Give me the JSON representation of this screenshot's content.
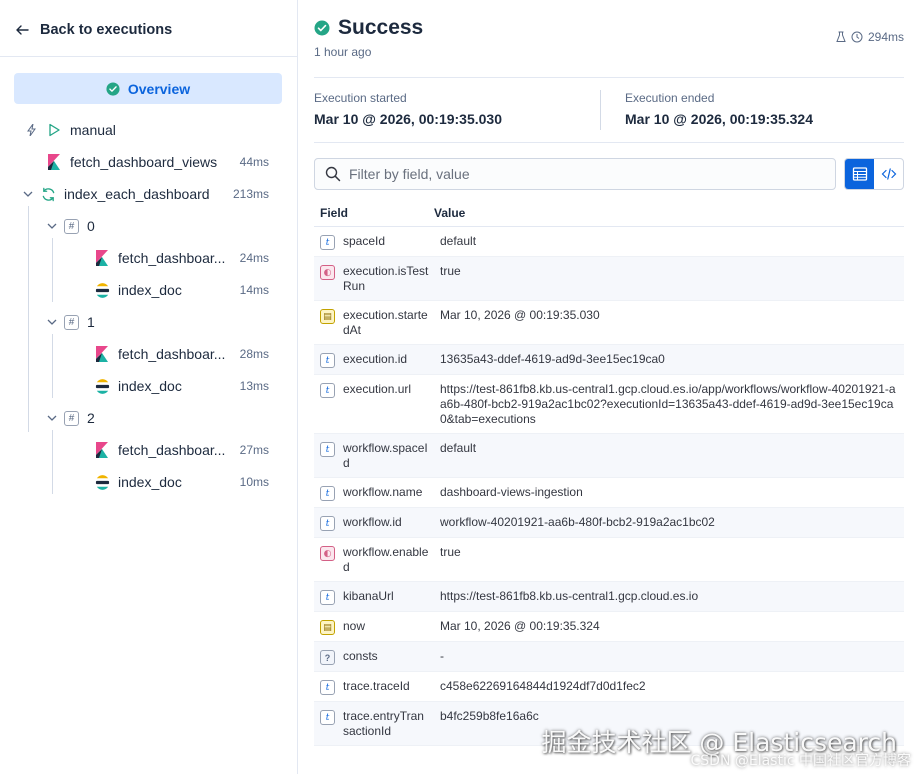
{
  "sidebar": {
    "back_label": "Back to executions",
    "overview_label": "Overview",
    "steps": [
      {
        "label": "manual",
        "duration": ""
      },
      {
        "label": "fetch_dashboard_views",
        "duration": "44ms"
      },
      {
        "label": "index_each_dashboard",
        "duration": "213ms"
      },
      {
        "label": "0",
        "duration": ""
      },
      {
        "label": "fetch_dashboar...",
        "duration": "24ms"
      },
      {
        "label": "index_doc",
        "duration": "14ms"
      },
      {
        "label": "1",
        "duration": ""
      },
      {
        "label": "fetch_dashboar...",
        "duration": "28ms"
      },
      {
        "label": "index_doc",
        "duration": "13ms"
      },
      {
        "label": "2",
        "duration": ""
      },
      {
        "label": "fetch_dashboar...",
        "duration": "27ms"
      },
      {
        "label": "index_doc",
        "duration": "10ms"
      }
    ]
  },
  "header": {
    "status": "Success",
    "time_ago": "1 hour ago",
    "total_duration": "294ms"
  },
  "summary": {
    "started_label": "Execution started",
    "started_value": "Mar 10 @ 2026, 00:19:35.030",
    "ended_label": "Execution ended",
    "ended_value": "Mar 10 @ 2026, 00:19:35.324"
  },
  "search": {
    "placeholder": "Filter by field, value"
  },
  "table": {
    "col_field": "Field",
    "col_value": "Value",
    "rows": [
      {
        "type": "t",
        "field": "spaceId",
        "value": "default"
      },
      {
        "type": "bool",
        "field": "execution.isTestRun",
        "value": "true"
      },
      {
        "type": "date",
        "field": "execution.startedAt",
        "value": "Mar 10, 2026 @ 00:19:35.030"
      },
      {
        "type": "t",
        "field": "execution.id",
        "value": "13635a43-ddef-4619-ad9d-3ee15ec19ca0"
      },
      {
        "type": "t",
        "field": "execution.url",
        "value": "https://test-861fb8.kb.us-central1.gcp.cloud.es.io/app/workflows/workflow-40201921-aa6b-480f-bcb2-919a2ac1bc02?executionId=13635a43-ddef-4619-ad9d-3ee15ec19ca0&tab=executions"
      },
      {
        "type": "t",
        "field": "workflow.spaceId",
        "value": "default"
      },
      {
        "type": "t",
        "field": "workflow.name",
        "value": "dashboard-views-ingestion"
      },
      {
        "type": "t",
        "field": "workflow.id",
        "value": "workflow-40201921-aa6b-480f-bcb2-919a2ac1bc02"
      },
      {
        "type": "bool",
        "field": "workflow.enabled",
        "value": "true"
      },
      {
        "type": "t",
        "field": "kibanaUrl",
        "value": "https://test-861fb8.kb.us-central1.gcp.cloud.es.io"
      },
      {
        "type": "date",
        "field": "now",
        "value": "Mar 10, 2026 @ 00:19:35.324"
      },
      {
        "type": "unk",
        "field": "consts",
        "value": "-"
      },
      {
        "type": "t",
        "field": "trace.traceId",
        "value": "c458e62269164844d1924df7d0d1fec2"
      },
      {
        "type": "t",
        "field": "trace.entryTransactionId",
        "value": "b4fc259b8fe16a6c"
      }
    ]
  },
  "watermark": {
    "main": "掘金技术社区 @ Elasticsearch",
    "sub": "CSDN @Elastic 中国社区官方博客"
  },
  "icons": {
    "accent": "#0b64dd",
    "success": "#24a586",
    "kibana_pink": "#e8478b",
    "kibana_teal": "#1cb2a5"
  }
}
